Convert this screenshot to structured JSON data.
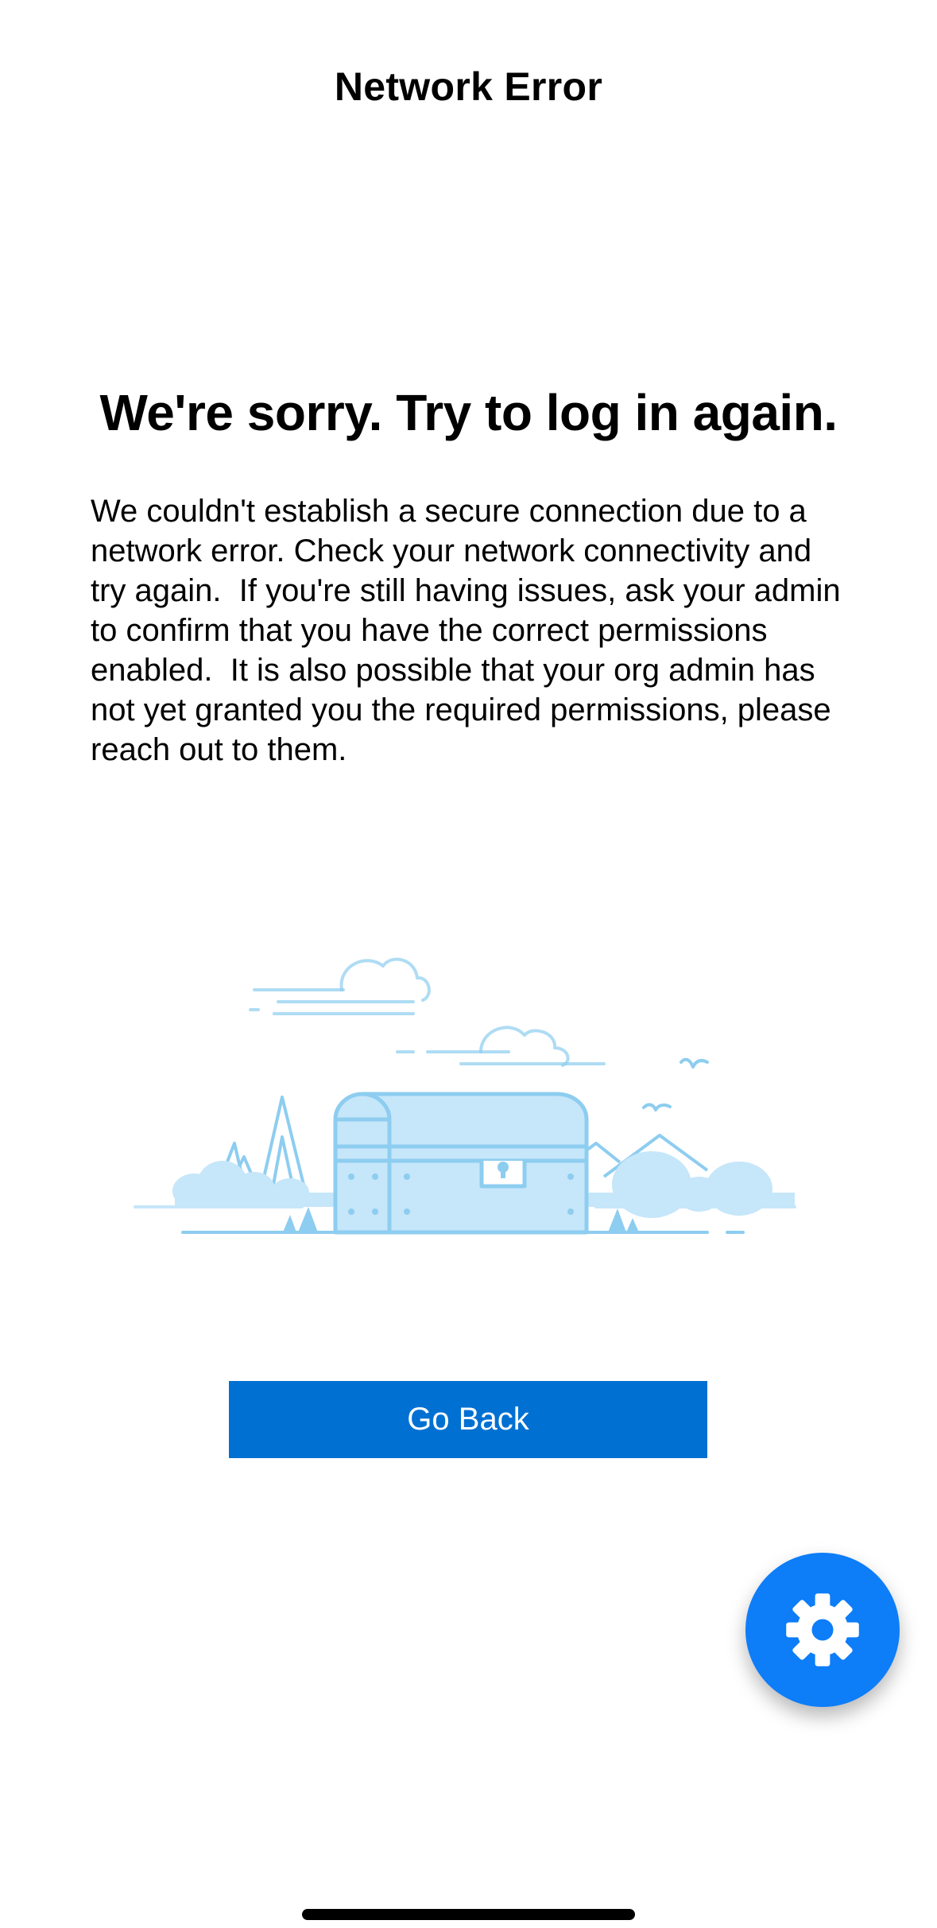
{
  "header": {
    "title": "Network Error"
  },
  "main": {
    "headline": "We're sorry. Try to log in again.",
    "message": "We couldn't establish a secure connection due to a network error. Check your network connectivity and try again.  If you're still having issues, ask your admin to confirm that you have the correct permissions enabled.  It is also possible that your org admin has not yet granted you the required permissions, please reach out to them.",
    "illustration_icon": "treasure-chest-landscape-illustration",
    "go_back_label": "Go Back"
  },
  "fab": {
    "icon": "gear-icon"
  },
  "colors": {
    "button": "#0070d2",
    "fab": "#0d7df8",
    "illustration_line": "#8dcdf0",
    "illustration_fill": "#c6e6fa"
  }
}
